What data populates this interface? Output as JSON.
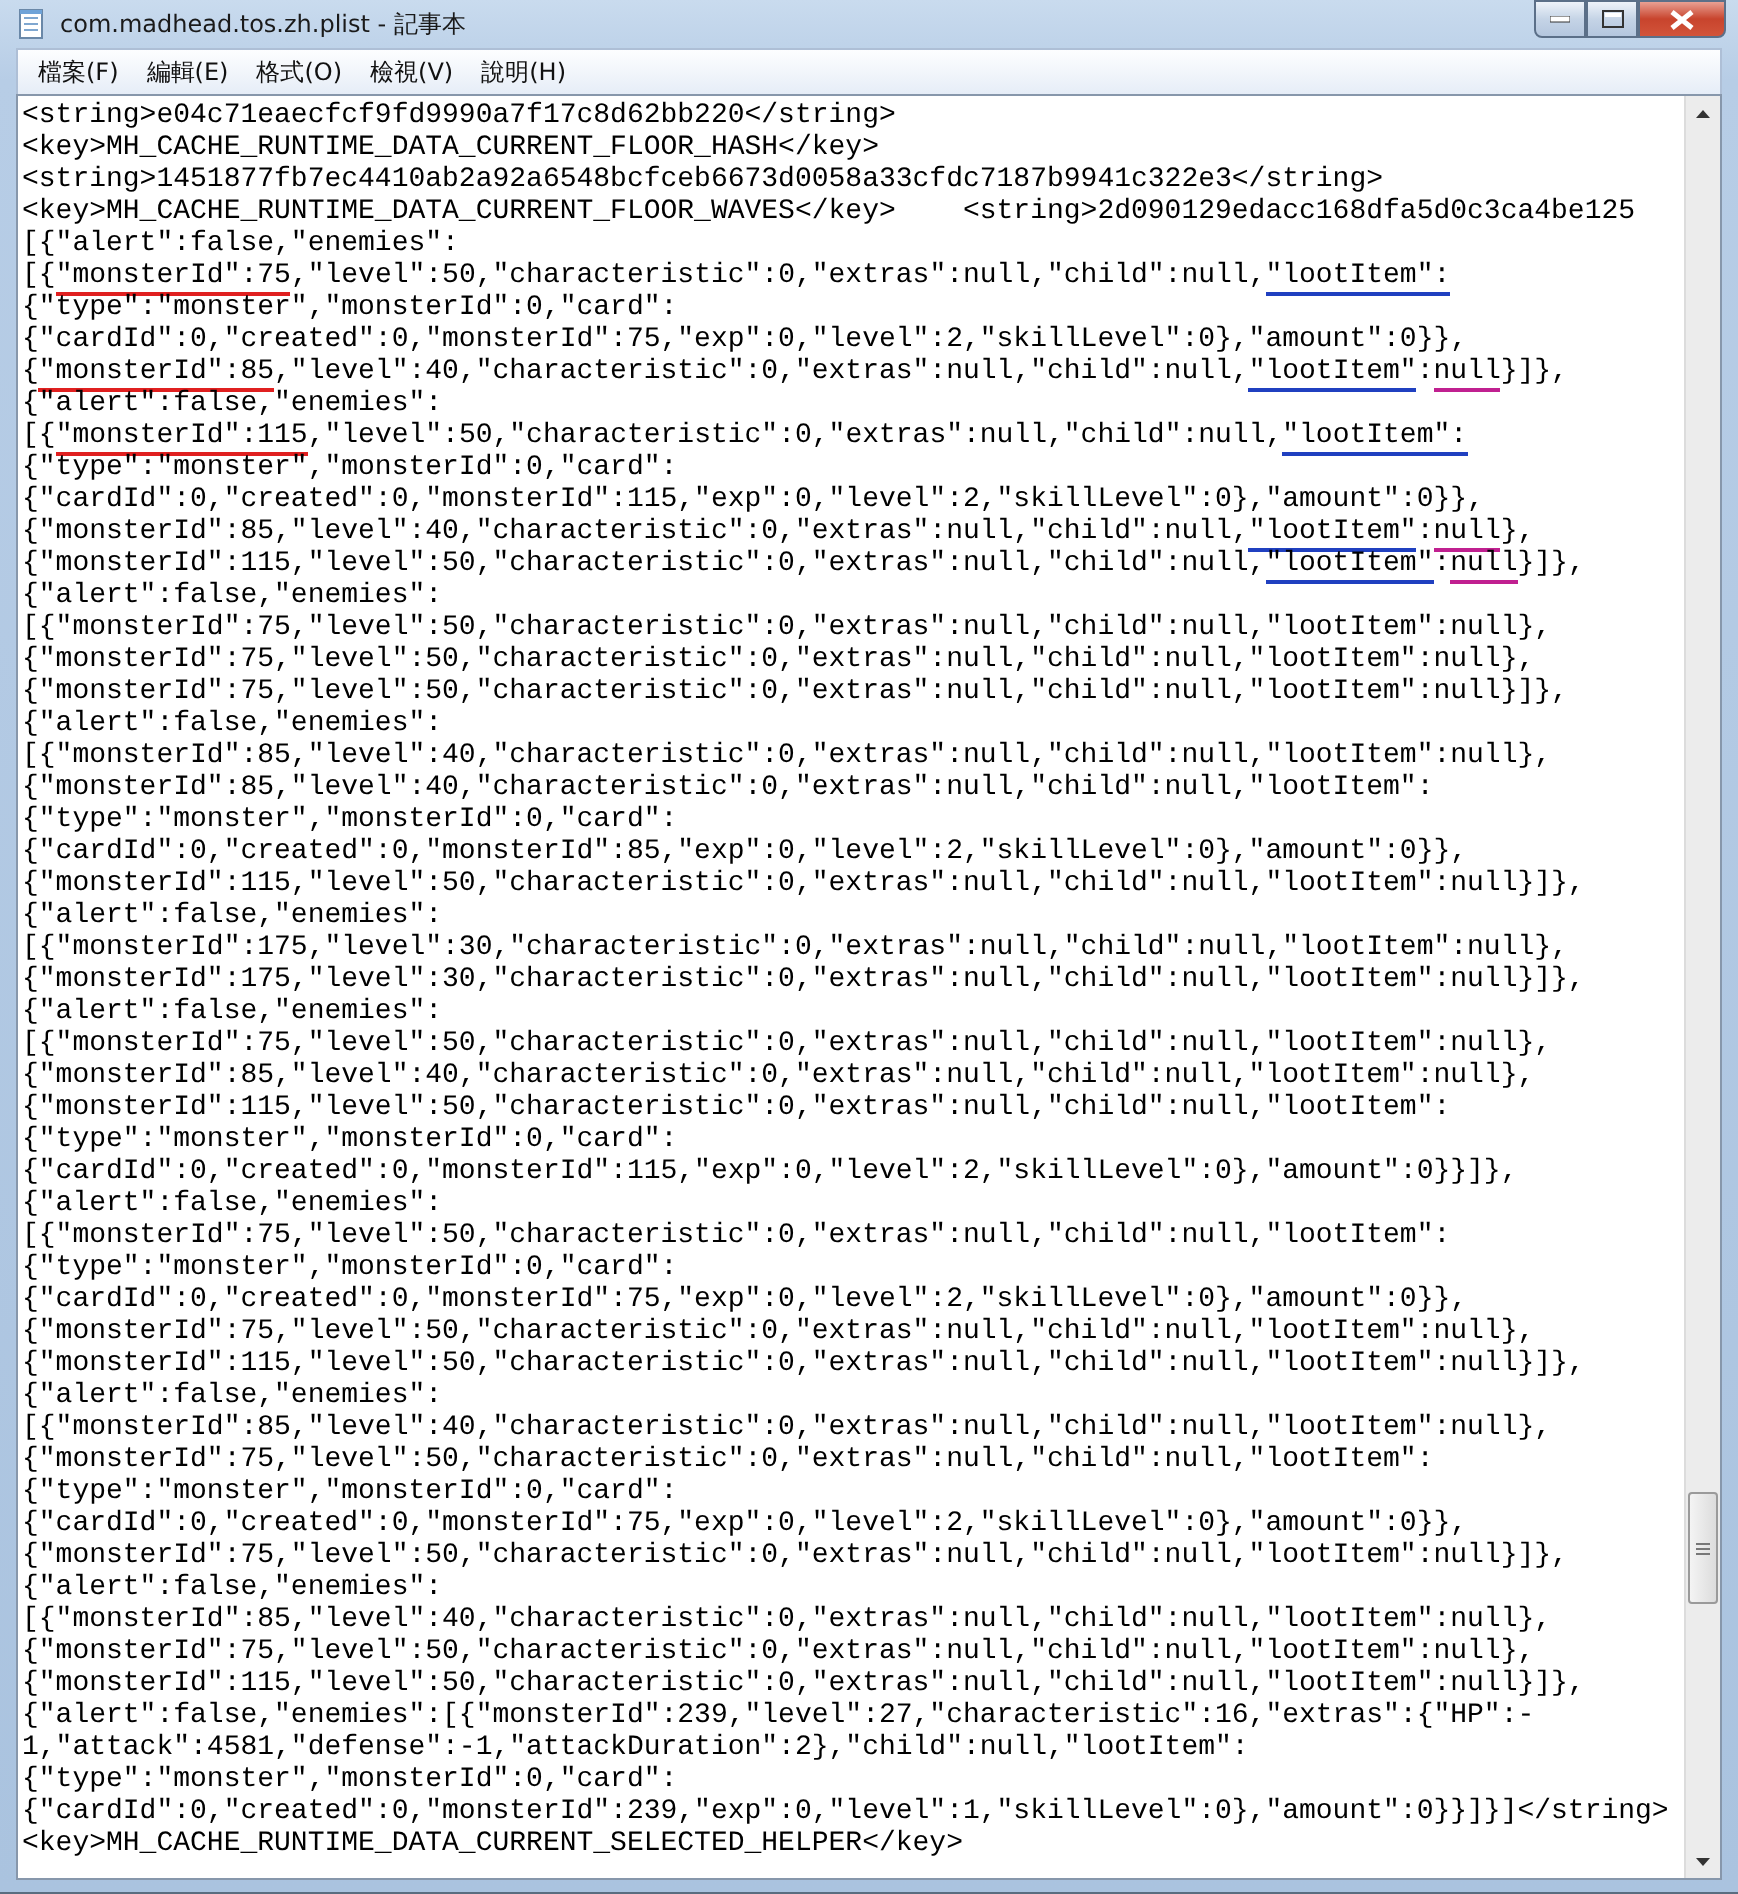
{
  "window": {
    "title": "com.madhead.tos.zh.plist - 記事本"
  },
  "menu": [
    "檔案(F)",
    "編輯(E)",
    "格式(O)",
    "檢視(V)",
    "說明(H)"
  ],
  "lines": [
    {
      "text": "<string>e04c71eaecfcf9fd9990a7f17c8d62bb220</string>"
    },
    {
      "text": "<key>MH_CACHE_RUNTIME_DATA_CURRENT_FLOOR_HASH</key>"
    },
    {
      "text": "<string>1451877fb7ec4410ab2a92a6548bcfceb6673d0058a33cfdc7187b9941c322e3</string>"
    },
    {
      "text": "<key>MH_CACHE_RUNTIME_DATA_CURRENT_FLOOR_WAVES</key>    <string>2d090129edacc168dfa5d0c3ca4be125"
    },
    {
      "text": "[{\"alert\":false,\"enemies\":"
    },
    {
      "parts": [
        {
          "text": "[{"
        },
        {
          "text": "\"monsterId\":75",
          "color": "#e02020"
        },
        {
          "text": ",\"level\":50,\"characteristic\":0,\"extras\":null,\"child\":null,"
        },
        {
          "text": "\"lootItem\":",
          "color": "#2040c0"
        }
      ]
    },
    {
      "text": "{\"type\":\"monster\",\"monsterId\":0,\"card\":"
    },
    {
      "text": "{\"cardId\":0,\"created\":0,\"monsterId\":75,\"exp\":0,\"level\":2,\"skillLevel\":0},\"amount\":0}},"
    },
    {
      "parts": [
        {
          "text": "{"
        },
        {
          "text": "\"monsterId\":85",
          "color": "#e02020"
        },
        {
          "text": ",\"level\":40,\"characteristic\":0,\"extras\":null,\"child\":null,"
        },
        {
          "text": "\"lootItem\"",
          "color": "#2040c0"
        },
        {
          "text": ":"
        },
        {
          "text": "null",
          "color": "#c02090"
        },
        {
          "text": "}]},"
        }
      ]
    },
    {
      "text": "{\"alert\":false,\"enemies\":"
    },
    {
      "parts": [
        {
          "text": "[{"
        },
        {
          "text": "\"monsterId\":115",
          "color": "#e02020"
        },
        {
          "text": ",\"level\":50,\"characteristic\":0,\"extras\":null,\"child\":null,"
        },
        {
          "text": "\"lootItem\":",
          "color": "#2040c0"
        }
      ]
    },
    {
      "text": "{\"type\":\"monster\",\"monsterId\":0,\"card\":"
    },
    {
      "text": "{\"cardId\":0,\"created\":0,\"monsterId\":115,\"exp\":0,\"level\":2,\"skillLevel\":0},\"amount\":0}},"
    },
    {
      "parts": [
        {
          "text": "{\"monsterId\":85,\"level\":40,\"characteristic\":0,\"extras\":null,\"child\":null,"
        },
        {
          "text": "\"lootItem\"",
          "color": "#2040c0"
        },
        {
          "text": ":"
        },
        {
          "text": "null",
          "color": "#c02090"
        },
        {
          "text": "},"
        }
      ]
    },
    {
      "parts": [
        {
          "text": "{\"monsterId\":115,\"level\":50,\"characteristic\":0,\"extras\":null,\"child\":null,"
        },
        {
          "text": "\"lootItem\"",
          "color": "#2040c0"
        },
        {
          "text": ":"
        },
        {
          "text": "null",
          "color": "#c02090"
        },
        {
          "text": "}]},"
        }
      ]
    },
    {
      "text": "{\"alert\":false,\"enemies\":"
    },
    {
      "text": "[{\"monsterId\":75,\"level\":50,\"characteristic\":0,\"extras\":null,\"child\":null,\"lootItem\":null},"
    },
    {
      "text": "{\"monsterId\":75,\"level\":50,\"characteristic\":0,\"extras\":null,\"child\":null,\"lootItem\":null},"
    },
    {
      "text": "{\"monsterId\":75,\"level\":50,\"characteristic\":0,\"extras\":null,\"child\":null,\"lootItem\":null}]},"
    },
    {
      "text": "{\"alert\":false,\"enemies\":"
    },
    {
      "text": "[{\"monsterId\":85,\"level\":40,\"characteristic\":0,\"extras\":null,\"child\":null,\"lootItem\":null},"
    },
    {
      "text": "{\"monsterId\":85,\"level\":40,\"characteristic\":0,\"extras\":null,\"child\":null,\"lootItem\":"
    },
    {
      "text": "{\"type\":\"monster\",\"monsterId\":0,\"card\":"
    },
    {
      "text": "{\"cardId\":0,\"created\":0,\"monsterId\":85,\"exp\":0,\"level\":2,\"skillLevel\":0},\"amount\":0}},"
    },
    {
      "text": "{\"monsterId\":115,\"level\":50,\"characteristic\":0,\"extras\":null,\"child\":null,\"lootItem\":null}]},"
    },
    {
      "text": "{\"alert\":false,\"enemies\":"
    },
    {
      "text": "[{\"monsterId\":175,\"level\":30,\"characteristic\":0,\"extras\":null,\"child\":null,\"lootItem\":null},"
    },
    {
      "text": "{\"monsterId\":175,\"level\":30,\"characteristic\":0,\"extras\":null,\"child\":null,\"lootItem\":null}]},"
    },
    {
      "text": "{\"alert\":false,\"enemies\":"
    },
    {
      "text": "[{\"monsterId\":75,\"level\":50,\"characteristic\":0,\"extras\":null,\"child\":null,\"lootItem\":null},"
    },
    {
      "text": "{\"monsterId\":85,\"level\":40,\"characteristic\":0,\"extras\":null,\"child\":null,\"lootItem\":null},"
    },
    {
      "text": "{\"monsterId\":115,\"level\":50,\"characteristic\":0,\"extras\":null,\"child\":null,\"lootItem\":"
    },
    {
      "text": "{\"type\":\"monster\",\"monsterId\":0,\"card\":"
    },
    {
      "text": "{\"cardId\":0,\"created\":0,\"monsterId\":115,\"exp\":0,\"level\":2,\"skillLevel\":0},\"amount\":0}}]},"
    },
    {
      "text": "{\"alert\":false,\"enemies\":"
    },
    {
      "text": "[{\"monsterId\":75,\"level\":50,\"characteristic\":0,\"extras\":null,\"child\":null,\"lootItem\":"
    },
    {
      "text": "{\"type\":\"monster\",\"monsterId\":0,\"card\":"
    },
    {
      "text": "{\"cardId\":0,\"created\":0,\"monsterId\":75,\"exp\":0,\"level\":2,\"skillLevel\":0},\"amount\":0}},"
    },
    {
      "text": "{\"monsterId\":75,\"level\":50,\"characteristic\":0,\"extras\":null,\"child\":null,\"lootItem\":null},"
    },
    {
      "text": "{\"monsterId\":115,\"level\":50,\"characteristic\":0,\"extras\":null,\"child\":null,\"lootItem\":null}]},"
    },
    {
      "text": "{\"alert\":false,\"enemies\":"
    },
    {
      "text": "[{\"monsterId\":85,\"level\":40,\"characteristic\":0,\"extras\":null,\"child\":null,\"lootItem\":null},"
    },
    {
      "text": "{\"monsterId\":75,\"level\":50,\"characteristic\":0,\"extras\":null,\"child\":null,\"lootItem\":"
    },
    {
      "text": "{\"type\":\"monster\",\"monsterId\":0,\"card\":"
    },
    {
      "text": "{\"cardId\":0,\"created\":0,\"monsterId\":75,\"exp\":0,\"level\":2,\"skillLevel\":0},\"amount\":0}},"
    },
    {
      "text": "{\"monsterId\":75,\"level\":50,\"characteristic\":0,\"extras\":null,\"child\":null,\"lootItem\":null}]},"
    },
    {
      "text": "{\"alert\":false,\"enemies\":"
    },
    {
      "text": "[{\"monsterId\":85,\"level\":40,\"characteristic\":0,\"extras\":null,\"child\":null,\"lootItem\":null},"
    },
    {
      "text": "{\"monsterId\":75,\"level\":50,\"characteristic\":0,\"extras\":null,\"child\":null,\"lootItem\":null},"
    },
    {
      "text": "{\"monsterId\":115,\"level\":50,\"characteristic\":0,\"extras\":null,\"child\":null,\"lootItem\":null}]},"
    },
    {
      "text": "{\"alert\":false,\"enemies\":[{\"monsterId\":239,\"level\":27,\"characteristic\":16,\"extras\":{\"HP\":-"
    },
    {
      "text": "1,\"attack\":4581,\"defense\":-1,\"attackDuration\":2},\"child\":null,\"lootItem\":"
    },
    {
      "text": "{\"type\":\"monster\",\"monsterId\":0,\"card\":"
    },
    {
      "text": "{\"cardId\":0,\"created\":0,\"monsterId\":239,\"exp\":0,\"level\":1,\"skillLevel\":0},\"amount\":0}}]}]</string>"
    },
    {
      "text": "<key>MH_CACHE_RUNTIME_DATA_CURRENT_SELECTED_HELPER</key>"
    }
  ]
}
